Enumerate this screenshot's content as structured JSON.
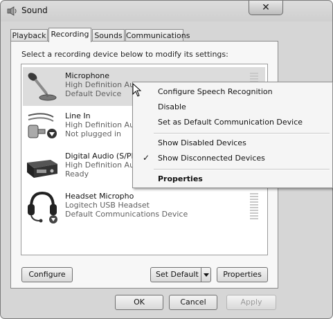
{
  "window": {
    "title": "Sound",
    "close_glyph": "✕"
  },
  "tabs": [
    {
      "label": "Playback",
      "active": false
    },
    {
      "label": "Recording",
      "active": true
    },
    {
      "label": "Sounds",
      "active": false
    },
    {
      "label": "Communications",
      "active": false
    }
  ],
  "panel": {
    "prompt": "Select a recording device below to modify its settings:"
  },
  "devices": [
    {
      "name": "Microphone",
      "description": "High Definition Au",
      "status": "Default Device",
      "icon": "microphone-icon",
      "selected": true
    },
    {
      "name": "Line In",
      "description": "High Definition Au",
      "status": "Not plugged in",
      "icon": "line-in-cable-icon",
      "selected": false
    },
    {
      "name": "Digital Audio (S/PD",
      "description": "High Definition Au",
      "status": "Ready",
      "icon": "digital-audio-icon",
      "selected": false
    },
    {
      "name": "Headset Micropho",
      "description": "Logitech USB Headset",
      "status": "Default Communications Device",
      "icon": "headset-icon",
      "selected": false
    }
  ],
  "buttons": {
    "configure": "Configure",
    "set_default": "Set Default",
    "properties": "Properties",
    "ok": "OK",
    "cancel": "Cancel",
    "apply": "Apply"
  },
  "context_menu": {
    "items": [
      {
        "label": "Configure Speech Recognition",
        "checked": false,
        "bold": false
      },
      {
        "label": "Disable",
        "checked": false,
        "bold": false
      },
      {
        "label": "Set as Default Communication Device",
        "checked": false,
        "bold": false
      },
      {
        "label": "Show Disabled Devices",
        "checked": false,
        "bold": false
      },
      {
        "label": "Show Disconnected Devices",
        "checked": true,
        "bold": false
      },
      {
        "label": "Properties",
        "checked": false,
        "bold": true
      }
    ],
    "check_glyph": "✓"
  }
}
